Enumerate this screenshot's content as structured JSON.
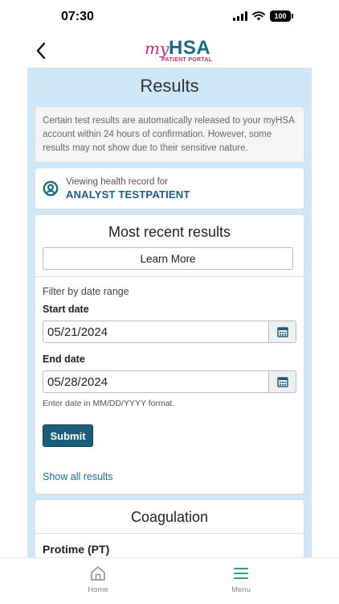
{
  "status_bar": {
    "time": "07:30",
    "battery": "100"
  },
  "header": {
    "logo_my": "my",
    "logo_hsa": "HSA",
    "logo_sub": "PATIENT PORTAL"
  },
  "page": {
    "title": "Results"
  },
  "notice": {
    "text": "Certain test results are automatically released to your myHSA account within 24 hours of confirmation. However, some results may not show due to their sensitive nature."
  },
  "record": {
    "label": "Viewing health record for",
    "patient_name": "ANALYST TESTPATIENT"
  },
  "recent": {
    "title": "Most recent results",
    "learn_more_label": "Learn More",
    "filter_label": "Filter by date range",
    "start_label": "Start date",
    "start_value": "05/21/2024",
    "end_label": "End date",
    "end_value": "05/28/2024",
    "hint": "Enter date in MM/DD/YYYY format.",
    "submit_label": "Submit",
    "show_all_label": "Show all results"
  },
  "coagulation": {
    "title": "Coagulation",
    "first_test": "Protime (PT)"
  },
  "bottom_nav": {
    "home_label": "Home",
    "menu_label": "Menu"
  },
  "colors": {
    "accent": "#1b5e7a",
    "brand_pink": "#c0306a",
    "brand_teal": "#1b6a83",
    "content_bg": "#cfe7f7",
    "menu_icon": "#2a9d8f"
  }
}
